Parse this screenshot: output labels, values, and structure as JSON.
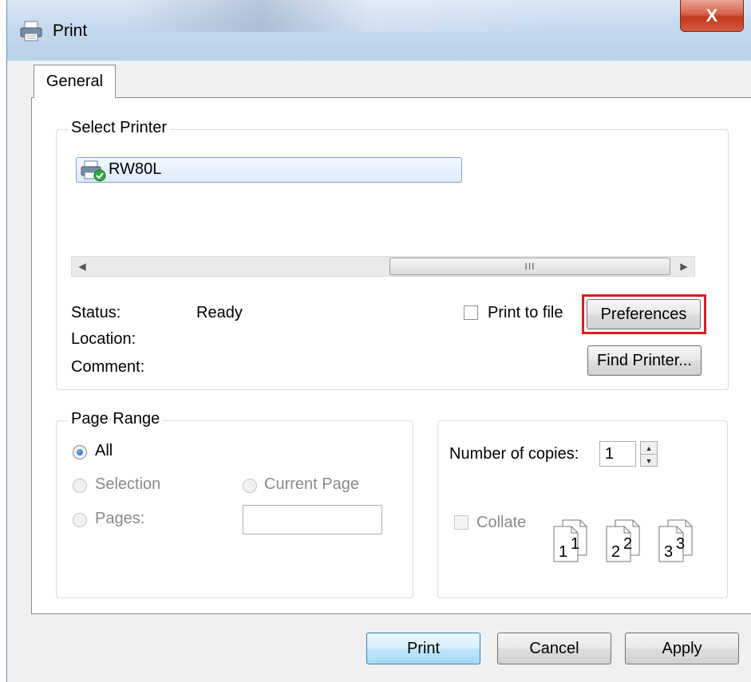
{
  "window": {
    "title": "Print",
    "close_glyph": "X"
  },
  "tabs": [
    {
      "label": "General"
    }
  ],
  "select_printer": {
    "title": "Select Printer",
    "printers": [
      {
        "name": "RW80L"
      }
    ],
    "status_label": "Status:",
    "status_value": "Ready",
    "location_label": "Location:",
    "location_value": "",
    "comment_label": "Comment:",
    "comment_value": "",
    "print_to_file_label": "Print to file",
    "print_to_file_checked": false,
    "preferences_label": "Preferences",
    "find_printer_label": "Find Printer..."
  },
  "page_range": {
    "title": "Page Range",
    "all_label": "All",
    "selection_label": "Selection",
    "current_page_label": "Current Page",
    "pages_label": "Pages:",
    "pages_value": "",
    "selected": "All"
  },
  "copies": {
    "label": "Number of copies:",
    "value": "1",
    "collate_label": "Collate",
    "collate_checked": false,
    "collate_pages": [
      "1",
      "1",
      "2",
      "2",
      "3",
      "3"
    ]
  },
  "footer": {
    "print_label": "Print",
    "cancel_label": "Cancel",
    "apply_label": "Apply"
  },
  "colors": {
    "highlight": "#d81e1e",
    "close_button": "#c0391f",
    "selection": "#dcebfc"
  },
  "icons": [
    "printer-icon",
    "close-icon",
    "scroll-left-icon",
    "scroll-right-icon",
    "spin-up-icon",
    "spin-down-icon",
    "collate-pages-icon"
  ]
}
